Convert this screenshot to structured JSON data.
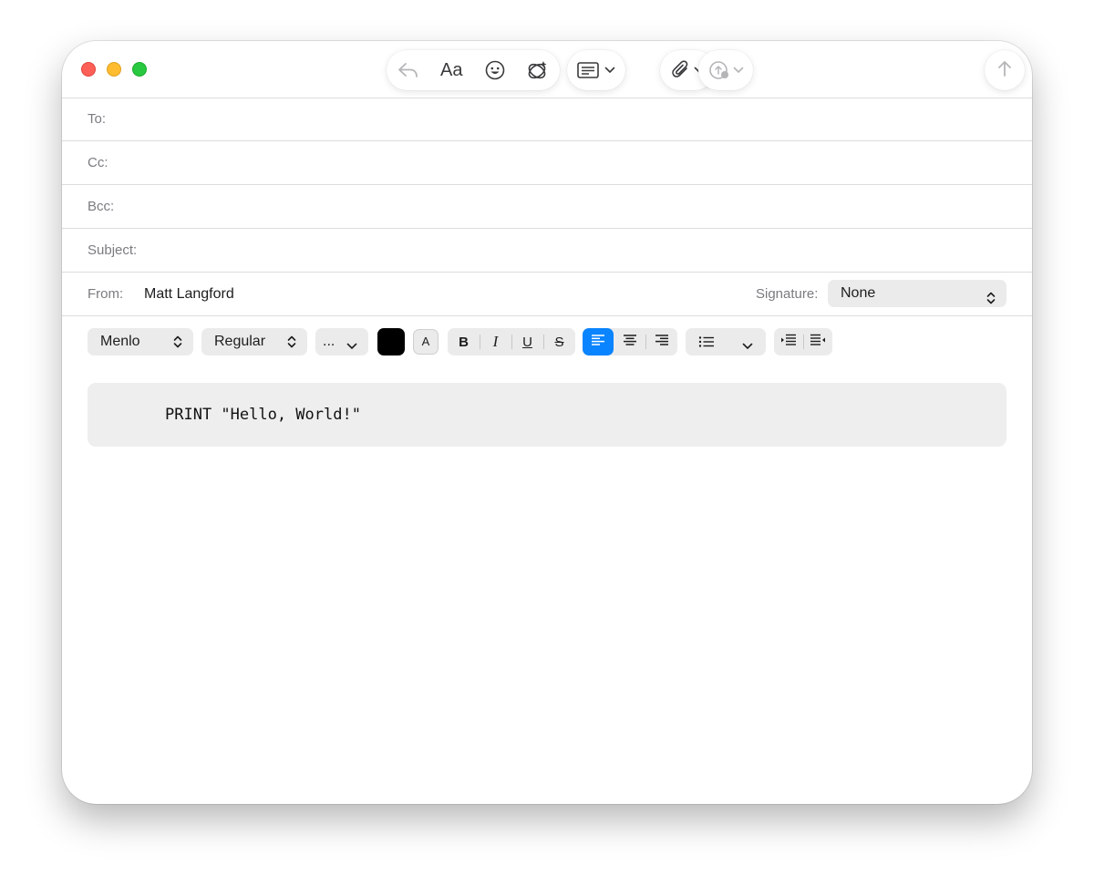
{
  "window": {
    "traffic_lights": [
      "close",
      "minimize",
      "zoom"
    ],
    "colors": {
      "close": "#fe5f57",
      "minimize": "#febc2e",
      "zoom": "#28c840",
      "accent": "#0a84ff"
    }
  },
  "toolbar": {
    "format_label": "Aa",
    "icons": [
      "reply-icon",
      "emoji-icon",
      "writing-tools-icon",
      "header-fields-icon",
      "attachment-icon",
      "photo-browser-icon",
      "send-icon"
    ]
  },
  "header": {
    "to_label": "To:",
    "cc_label": "Cc:",
    "bcc_label": "Bcc:",
    "subject_label": "Subject:",
    "from_label": "From:",
    "from_value": "Matt Langford",
    "signature_label": "Signature:",
    "signature_value": "None"
  },
  "format_bar": {
    "font_family": "Menlo",
    "font_style": "Regular",
    "font_size": "...",
    "text_color": "#000000",
    "highlight_label": "A",
    "bold_label": "B",
    "italic_label": "I",
    "underline_label": "U",
    "strike_label": "S",
    "alignment_selected": "left"
  },
  "body": {
    "code_text": "PRINT \"Hello, World!\""
  }
}
